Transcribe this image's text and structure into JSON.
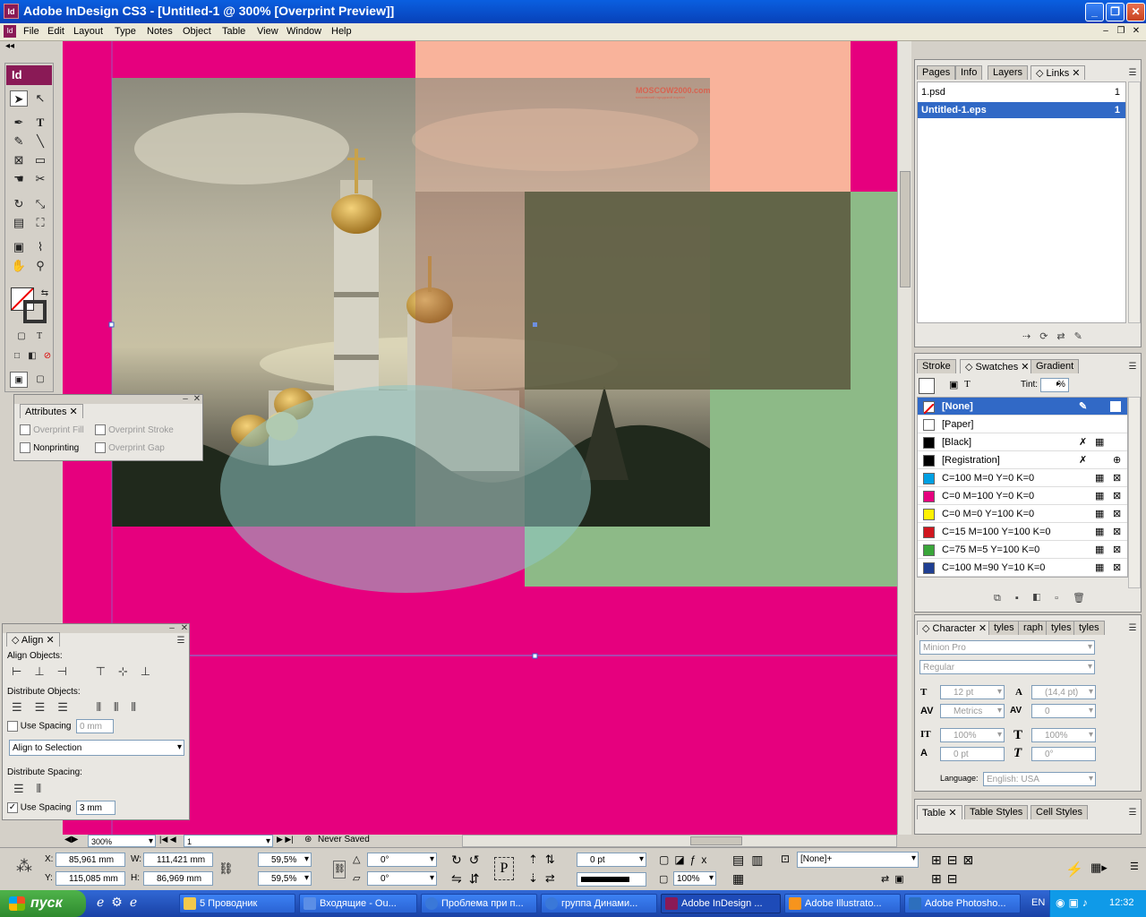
{
  "window": {
    "title": "Adobe InDesign CS3 - [Untitled-1 @ 300% [Overprint Preview]]",
    "app_icon": "Id",
    "buttons": [
      "minimize",
      "maximize",
      "close"
    ]
  },
  "menu": [
    "File",
    "Edit",
    "Layout",
    "Type",
    "Notes",
    "Object",
    "Table",
    "View",
    "Window",
    "Help"
  ],
  "toolbox": {
    "logo": "Id",
    "tools": [
      "selection",
      "direct-selection",
      "pen",
      "type",
      "pencil",
      "line",
      "rectangle-frame",
      "rectangle",
      "scissors",
      "free-transform",
      "gradient",
      "note",
      "eyedropper",
      "hand",
      "zoom",
      "fill-stroke",
      "formatting",
      "view-mode"
    ]
  },
  "artwork": {
    "watermark": "MOSCOW2000.com",
    "watermark_sub": "московский городской портал",
    "colors": {
      "page_magenta": "#e6007e",
      "salmon": "#f9b39b",
      "green": "#8dba87",
      "olive": "#5e5d42",
      "ellipse": "#8fc6c4"
    }
  },
  "attributes_panel": {
    "tab": "Attributes",
    "items": [
      {
        "label": "Overprint Fill",
        "checked": false,
        "enabled": false
      },
      {
        "label": "Overprint Stroke",
        "checked": false,
        "enabled": false
      },
      {
        "label": "Nonprinting",
        "checked": false,
        "enabled": true
      },
      {
        "label": "Overprint Gap",
        "checked": false,
        "enabled": false
      }
    ]
  },
  "align_panel": {
    "tab": "Align",
    "align_objects": "Align Objects:",
    "distribute_objects": "Distribute Objects:",
    "use_spacing_1": "Use Spacing",
    "use_spacing_1_value": "0 mm",
    "align_to": "Align to Selection",
    "distribute_spacing": "Distribute Spacing:",
    "use_spacing_2": "Use Spacing",
    "use_spacing_2_value": "3 mm"
  },
  "links_panel": {
    "tabs": [
      "Pages",
      "Info",
      "Layers",
      "Links"
    ],
    "items": [
      {
        "name": "1.psd",
        "page": "1"
      },
      {
        "name": "Untitled-1.eps",
        "page": "1"
      }
    ]
  },
  "swatches_panel": {
    "tabs": [
      "Stroke",
      "Swatches",
      "Gradient"
    ],
    "tint_label": "Tint:",
    "tint_unit": "%",
    "swatches": [
      {
        "name": "[None]",
        "color": "none"
      },
      {
        "name": "[Paper]",
        "color": "#ffffff"
      },
      {
        "name": "[Black]",
        "color": "#000000"
      },
      {
        "name": "[Registration]",
        "color": "#000000"
      },
      {
        "name": "C=100 M=0 Y=0 K=0",
        "color": "#00a0e3"
      },
      {
        "name": "C=0 M=100 Y=0 K=0",
        "color": "#e6007e"
      },
      {
        "name": "C=0 M=0 Y=100 K=0",
        "color": "#fff200"
      },
      {
        "name": "C=15 M=100 Y=100 K=0",
        "color": "#d0161f"
      },
      {
        "name": "C=75 M=5 Y=100 K=0",
        "color": "#3aa63a"
      },
      {
        "name": "C=100 M=90 Y=10 K=0",
        "color": "#1f3f92"
      }
    ]
  },
  "character_panel": {
    "tabs": [
      "Character",
      "tyles",
      "raph",
      "tyles",
      "tyles"
    ],
    "font": "Minion Pro",
    "style": "Regular",
    "size": "12 pt",
    "leading": "(14,4 pt)",
    "kerning": "Metrics",
    "tracking": "0",
    "v_scale": "100%",
    "h_scale": "100%",
    "baseline": "0 pt",
    "skew": "0°",
    "language_label": "Language:",
    "language": "English: USA"
  },
  "bottom_tabs": [
    "Table",
    "Table Styles",
    "Cell Styles"
  ],
  "status": {
    "zoom": "300%",
    "page": "1",
    "save_state": "Never Saved"
  },
  "control_panel": {
    "x_label": "X:",
    "x": "85,961 mm",
    "y_label": "Y:",
    "y": "115,085 mm",
    "w_label": "W:",
    "w": "111,421 mm",
    "h_label": "H:",
    "h": "86,969 mm",
    "scale_x": "59,5%",
    "scale_y": "59,5%",
    "rotate": "0°",
    "shear": "0°",
    "stroke_weight": "0 pt",
    "opacity": "100%",
    "style": "[None]+"
  },
  "taskbar": {
    "start": "пуск",
    "tasks": [
      {
        "label": "5 Проводник",
        "color": "#f2c94c"
      },
      {
        "label": "Входящие - Ou...",
        "color": "#5b8ee6"
      },
      {
        "label": "Проблема при п...",
        "color": "#3a78d8"
      },
      {
        "label": "группа Динами...",
        "color": "#3a78d8"
      },
      {
        "label": "Adobe InDesign ...",
        "color": "#8a1a56"
      },
      {
        "label": "Adobe Illustrato...",
        "color": "#f7941d"
      },
      {
        "label": "Adobe Photosho...",
        "color": "#2d6fbd"
      }
    ],
    "lang": "EN",
    "clock": "12:32"
  }
}
